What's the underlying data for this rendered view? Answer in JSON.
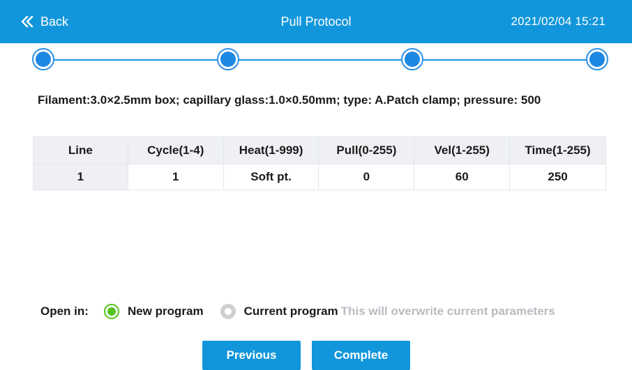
{
  "header": {
    "back_label": "Back",
    "title": "Pull Protocol",
    "datetime": "2021/02/04  15:21",
    "color": "#1296db"
  },
  "stepper": {
    "step_count": 4,
    "active_color": "#1e88e5"
  },
  "info": {
    "text": "Filament:3.0×2.5mm box; capillary glass:1.0×0.50mm; type: A.Patch clamp; pressure: 500"
  },
  "table": {
    "headers": [
      "Line",
      "Cycle(1-4)",
      "Heat(1-999)",
      "Pull(0-255)",
      "Vel(1-255)",
      "Time(1-255)"
    ],
    "rows": [
      [
        "1",
        "1",
        "Soft pt.",
        "0",
        "60",
        "250"
      ]
    ]
  },
  "open_in": {
    "label": "Open in:",
    "options": [
      {
        "label": "New program",
        "selected": true
      },
      {
        "label": "Current program",
        "selected": false
      }
    ],
    "warning": "This will overwrite current parameters"
  },
  "buttons": {
    "previous": "Previous",
    "complete": "Complete"
  },
  "colors": {
    "accent": "#1296db",
    "radio_selected": "#52c41a",
    "radio_unselected": "#cfcfcf",
    "muted_text": "#b7bcc2"
  }
}
